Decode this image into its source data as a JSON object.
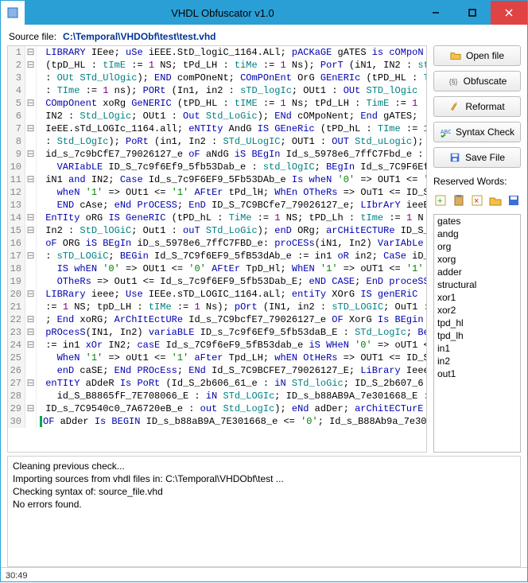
{
  "window": {
    "title": "VHDL Obfuscator v1.0"
  },
  "source": {
    "label": "Source file:",
    "path": "C:\\Temporal\\VHDObf\\test\\test.vhd"
  },
  "buttons": {
    "open": "Open file",
    "obfuscate": "Obfuscate",
    "reformat": "Reformat",
    "syntax": "Syntax Check",
    "save": "Save File"
  },
  "reserved": {
    "label": "Reserved Words:",
    "items": [
      "gates",
      "andg",
      "org",
      "xorg",
      "adder",
      "structural",
      "xor1",
      "xor2",
      "tpd_hl",
      "tpd_lh",
      "in1",
      "in2",
      "out1"
    ]
  },
  "console": [
    "Cleaning previous check...",
    "Importing sources from vhdl files in: C:\\Temporal\\VHDObf\\test ...",
    "Checking syntax of: source_file.vhd",
    "No errors found."
  ],
  "status": {
    "pos": "30:49"
  },
  "code": [
    {
      "n": 1,
      "f": "⊟",
      "html": " <span class='kw'>LIBRARY</span> IEee; <span class='kw'>uSe</span> iEEE.StD_logiC_1164.ALl; <span class='kw'>pACKaGE</span> gATES <span class='kw'>is</span> <span class='kw'>cOMpoN</span>"
    },
    {
      "n": 2,
      "f": "⊟",
      "html": " (tpD_HL : <span class='ty'>tImE</span> := <span class='num'>1</span> NS; tPd_LH : <span class='ty'>tiMe</span> := <span class='num'>1</span> Ns); <span class='kw'>PorT</span> (iN1, IN2 : <span class='ty'>st</span>"
    },
    {
      "n": 3,
      "f": "",
      "html": " : <span class='ty'>OUt STd_UlOgic</span>); <span class='kw'>END</span> comPOneNt; <span class='kw'>COmPOnEnt</span> OrG <span class='kw'>GEnERIc</span> (tPD_HL : <span class='ty'>T</span>"
    },
    {
      "n": 4,
      "f": "",
      "html": " : <span class='ty'>TIme</span> := <span class='num'>1</span> ns); <span class='kw'>PORt</span> (In1, in2 : <span class='ty'>sTD_logIc</span>; OUt1 : <span class='kw'>OUt</span> <span class='ty'>STD_lOgic</span>"
    },
    {
      "n": 5,
      "f": "⊟",
      "html": " <span class='kw'>COmpOnent</span> xoRg <span class='kw'>GeNERIC</span> (tPD_HL : <span class='ty'>tIME</span> := <span class='num'>1</span> Ns; tPd_LH : <span class='ty'>TimE</span> := <span class='num'>1</span>"
    },
    {
      "n": 6,
      "f": "",
      "html": " IN2 : <span class='ty'>Std_LOgic</span>; OUt1 : <span class='kw'>Out</span> <span class='ty'>Std_LoGic</span>); <span class='kw'>ENd</span> cOMpoNent; <span class='kw'>End</span> gATES;"
    },
    {
      "n": 7,
      "f": "⊟",
      "html": " IeEE.sTd_LOGIc_1164.all; <span class='kw'>eNTIty</span> AndG <span class='kw'>IS GEneRic</span> (tPD_hL : <span class='ty'>TIme</span> := <span class='num'>1</span>"
    },
    {
      "n": 8,
      "f": "",
      "html": " : <span class='ty'>Std_LOgIc</span>); <span class='kw'>PoRt</span> (in1, In2 : <span class='ty'>STd_ULogIC</span>; OUT1 : <span class='kw'>OUT</span> <span class='ty'>Std_uLogic</span>);"
    },
    {
      "n": 9,
      "f": "⊟",
      "html": " id_s_7c9bCfE7_79026127_e <span class='kw'>oF</span> aNdG <span class='kw'>iS BEgIn</span> Id_s_5978e6_7ffC7Fbd_e : "
    },
    {
      "n": 10,
      "f": "",
      "html": "   <span class='kw'>VARIabLE</span> ID_S_7c9f6Ef9_5fb53Dab_e : <span class='ty'>std_lOgIC</span>; <span class='kw'>BEgIn</span> Id_s_7C9F6Ef9"
    },
    {
      "n": 11,
      "f": "⊟",
      "html": " iN1 <span class='kw'>and</span> IN2; <span class='kw'>Case</span> Id_s_7c9F6EF9_5Fb53DAb_e <span class='kw'>Is wheN</span> <span class='str'>'0'</span> => OUT1 &lt;= '"
    },
    {
      "n": 12,
      "f": "",
      "html": "   <span class='kw'>wheN</span> <span class='str'>'1'</span> => OUt1 &lt;= <span class='str'>'1'</span> <span class='kw'>AFtEr</span> tPd_lH; <span class='kw'>WhEn OTheRs</span> => OuT1 &lt;= ID_S"
    },
    {
      "n": 13,
      "f": "",
      "html": "   <span class='kw'>END</span> cAse; <span class='kw'>eNd PrOCESS</span>; <span class='kw'>EnD</span> ID_S_7C9BCfe7_79026127_e; <span class='kw'>LIbrArY</span> ieeE;"
    },
    {
      "n": 14,
      "f": "⊟",
      "html": " <span class='kw'>EnTIty</span> oRG <span class='kw'>IS GeneRIC</span> (tPD_hL : <span class='ty'>TiMe</span> := <span class='num'>1</span> NS; tPD_Lh : <span class='ty'>tIme</span> := <span class='num'>1</span> N"
    },
    {
      "n": 15,
      "f": "⊟",
      "html": " In2 : <span class='ty'>StD_lOGiC</span>; Out1 : <span class='kw'>ouT</span> <span class='ty'>STd_LoGic</span>); <span class='kw'>enD</span> ORg; <span class='kw'>arCHitECTURe</span> ID_S_"
    },
    {
      "n": 16,
      "f": "",
      "html": " <span class='kw'>oF</span> ORG <span class='kw'>iS BEgIn</span> iD_s_5978e6_7ffC7FBD_e: <span class='kw'>proCESs</span>(iN1, In2) <span class='kw'>VarIAbLe</span>"
    },
    {
      "n": 17,
      "f": "⊟",
      "html": " : <span class='ty'>sTD_LOGiC</span>; <span class='kw'>BEGin</span> Id_S_7C9f6EF9_5fB53dAb_e := in1 <span class='kw'>oR</span> in2; <span class='kw'>CaSe</span> iD_"
    },
    {
      "n": 18,
      "f": "",
      "html": "   <span class='kw'>IS whEN</span> <span class='str'>'0'</span> => OUt1 &lt;= <span class='str'>'0'</span> <span class='kw'>AFtEr</span> TpD_Hl; <span class='kw'>WhEN</span> <span class='str'>'1'</span> => oUT1 &lt;= <span class='str'>'1'</span> <span class='kw'>AF</span>"
    },
    {
      "n": 19,
      "f": "",
      "html": "   <span class='kw'>OTheRs</span> => Out1 &lt;= Id_s_7c9f6EF9_5fb53Dab_E; <span class='kw'>eND CASE</span>; <span class='kw'>EnD proceSS</span>;"
    },
    {
      "n": 20,
      "f": "⊟",
      "html": " <span class='kw'>LIBRary</span> ieee; <span class='kw'>Use</span> IEEe.sTD_LOGIC_1164.aLl; <span class='kw'>entiTy</span> XOrG <span class='kw'>IS genERiC</span>"
    },
    {
      "n": 21,
      "f": "",
      "html": " := <span class='num'>1</span> NS; tpD_LH : <span class='ty'>tIMe</span> := <span class='num'>1</span> Ns); <span class='kw'>pOrt</span> (IN1, in2 : <span class='ty'>sTD_LOGIC</span>; OuT1 :"
    },
    {
      "n": 22,
      "f": "⊟",
      "html": " ; <span class='kw'>End</span> xoRG; <span class='kw'>ArChItEctURe</span> Id_s_7C9bcfE7_79026127_e <span class='kw'>OF</span> XorG <span class='kw'>Is BEgin</span>"
    },
    {
      "n": 23,
      "f": "⊟",
      "html": " <span class='kw'>pROcesS</span>(IN1, In2) <span class='kw'>variaBLE</span> ID_s_7c9f6Ef9_5fb53daB_E : <span class='ty'>STd_LogIc</span>; <span class='kw'>Be</span>"
    },
    {
      "n": 24,
      "f": "⊟",
      "html": " := in1 <span class='kw'>xOr</span> IN2; <span class='kw'>casE</span> Id_s_7C9f6eF9_5fB53dab_e <span class='kw'>iS WHeN</span> <span class='str'>'0'</span> => oUT1 &lt;"
    },
    {
      "n": 25,
      "f": "",
      "html": "   <span class='kw'>WheN</span> <span class='str'>'1'</span> => oUt1 &lt;= <span class='str'>'1'</span> <span class='kw'>aFter</span> Tpd_LH; <span class='kw'>whEN OtHeRs</span> => OUT1 &lt;= ID_S"
    },
    {
      "n": 26,
      "f": "",
      "html": "   <span class='kw'>enD</span> caSE; <span class='kw'>ENd PROcEss</span>; <span class='kw'>ENd</span> Id_S_7C9BCFE7_79026127_E; <span class='kw'>LiBrary</span> Ieee;"
    },
    {
      "n": 27,
      "f": "⊟",
      "html": " <span class='kw'>enTItY</span> aDdeR <span class='kw'>Is PoRt</span> (Id_S_2b606_61_e : <span class='kw'>iN</span> <span class='ty'>STd_loGic</span>; ID_S_2b607_6"
    },
    {
      "n": 28,
      "f": "",
      "html": "   id_S_B8865fF_7E708066_E : <span class='kw'>iN</span> <span class='ty'>STd_LOGIc</span>; ID_s_b88AB9A_7e301668_E :"
    },
    {
      "n": 29,
      "f": "⊟",
      "html": " ID_s_7C9540c0_7A6720eB_e : <span class='kw'>out</span> <span class='ty'>Std_LogIc</span>); <span class='kw'>eNd</span> adDer; <span class='kw'>arChitECTurE</span>"
    },
    {
      "n": 30,
      "f": "",
      "html": "<span class='cursor-bar'></span><span class='kw'>OF</span> aDder <span class='kw'>Is BEGIN</span> ID_s_b88aB9A_7E301668_e &lt;= <span class='str'>'0'</span>; Id_s_B88Ab9a_7e30"
    }
  ]
}
